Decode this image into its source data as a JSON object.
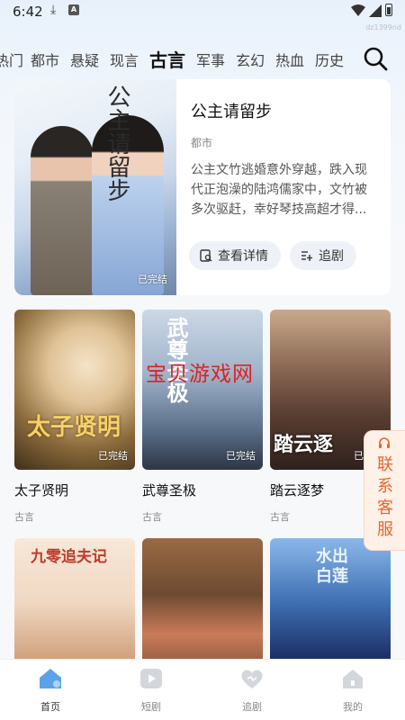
{
  "status_bar": {
    "time": "6:42",
    "corner_id": "dz1399nd"
  },
  "tabs": [
    {
      "label": "热门",
      "active": false
    },
    {
      "label": "都市",
      "active": false
    },
    {
      "label": "悬疑",
      "active": false
    },
    {
      "label": "现言",
      "active": false
    },
    {
      "label": "古言",
      "active": true
    },
    {
      "label": "军事",
      "active": false
    },
    {
      "label": "玄幻",
      "active": false
    },
    {
      "label": "热血",
      "active": false
    },
    {
      "label": "历史",
      "active": false
    }
  ],
  "featured": {
    "poster_title": "公主请留步",
    "badge": "已完结",
    "title": "公主请留步",
    "genre": "都市",
    "description": "公主文竹逃婚意外穿越，跌入现代正泡澡的陆鸿儒家中，文竹被多次驱赶，幸好琴技高超才得...",
    "details_label": "查看详情",
    "follow_label": "追剧"
  },
  "dramas": [
    {
      "title": "太子贤明",
      "genre": "古言",
      "badge": "已完结",
      "poster_text": "太子贤明"
    },
    {
      "title": "武尊圣极",
      "genre": "古言",
      "badge": "已完结",
      "poster_text": "武尊圣极"
    },
    {
      "title": "踏云逐梦",
      "genre": "古言",
      "badge": "已完结",
      "poster_text": "踏云逐"
    },
    {
      "title": "",
      "genre": "",
      "badge": "",
      "poster_text": "九零追夫记"
    },
    {
      "title": "",
      "genre": "",
      "badge": "",
      "poster_text": ""
    },
    {
      "title": "",
      "genre": "",
      "badge": "",
      "poster_text": "水出白莲"
    }
  ],
  "overlay_watermark": "宝贝游戏网",
  "customer_service": {
    "label": "联系客服"
  },
  "bottom_nav": [
    {
      "label": "首页",
      "icon": "home-icon",
      "active": true
    },
    {
      "label": "短剧",
      "icon": "play-icon",
      "active": false
    },
    {
      "label": "追剧",
      "icon": "heart-icon",
      "active": false
    },
    {
      "label": "我的",
      "icon": "profile-icon",
      "active": false
    }
  ],
  "colors": {
    "accent": "#4a90e2",
    "cs_text": "#e8652a",
    "watermark": "#e02020"
  }
}
